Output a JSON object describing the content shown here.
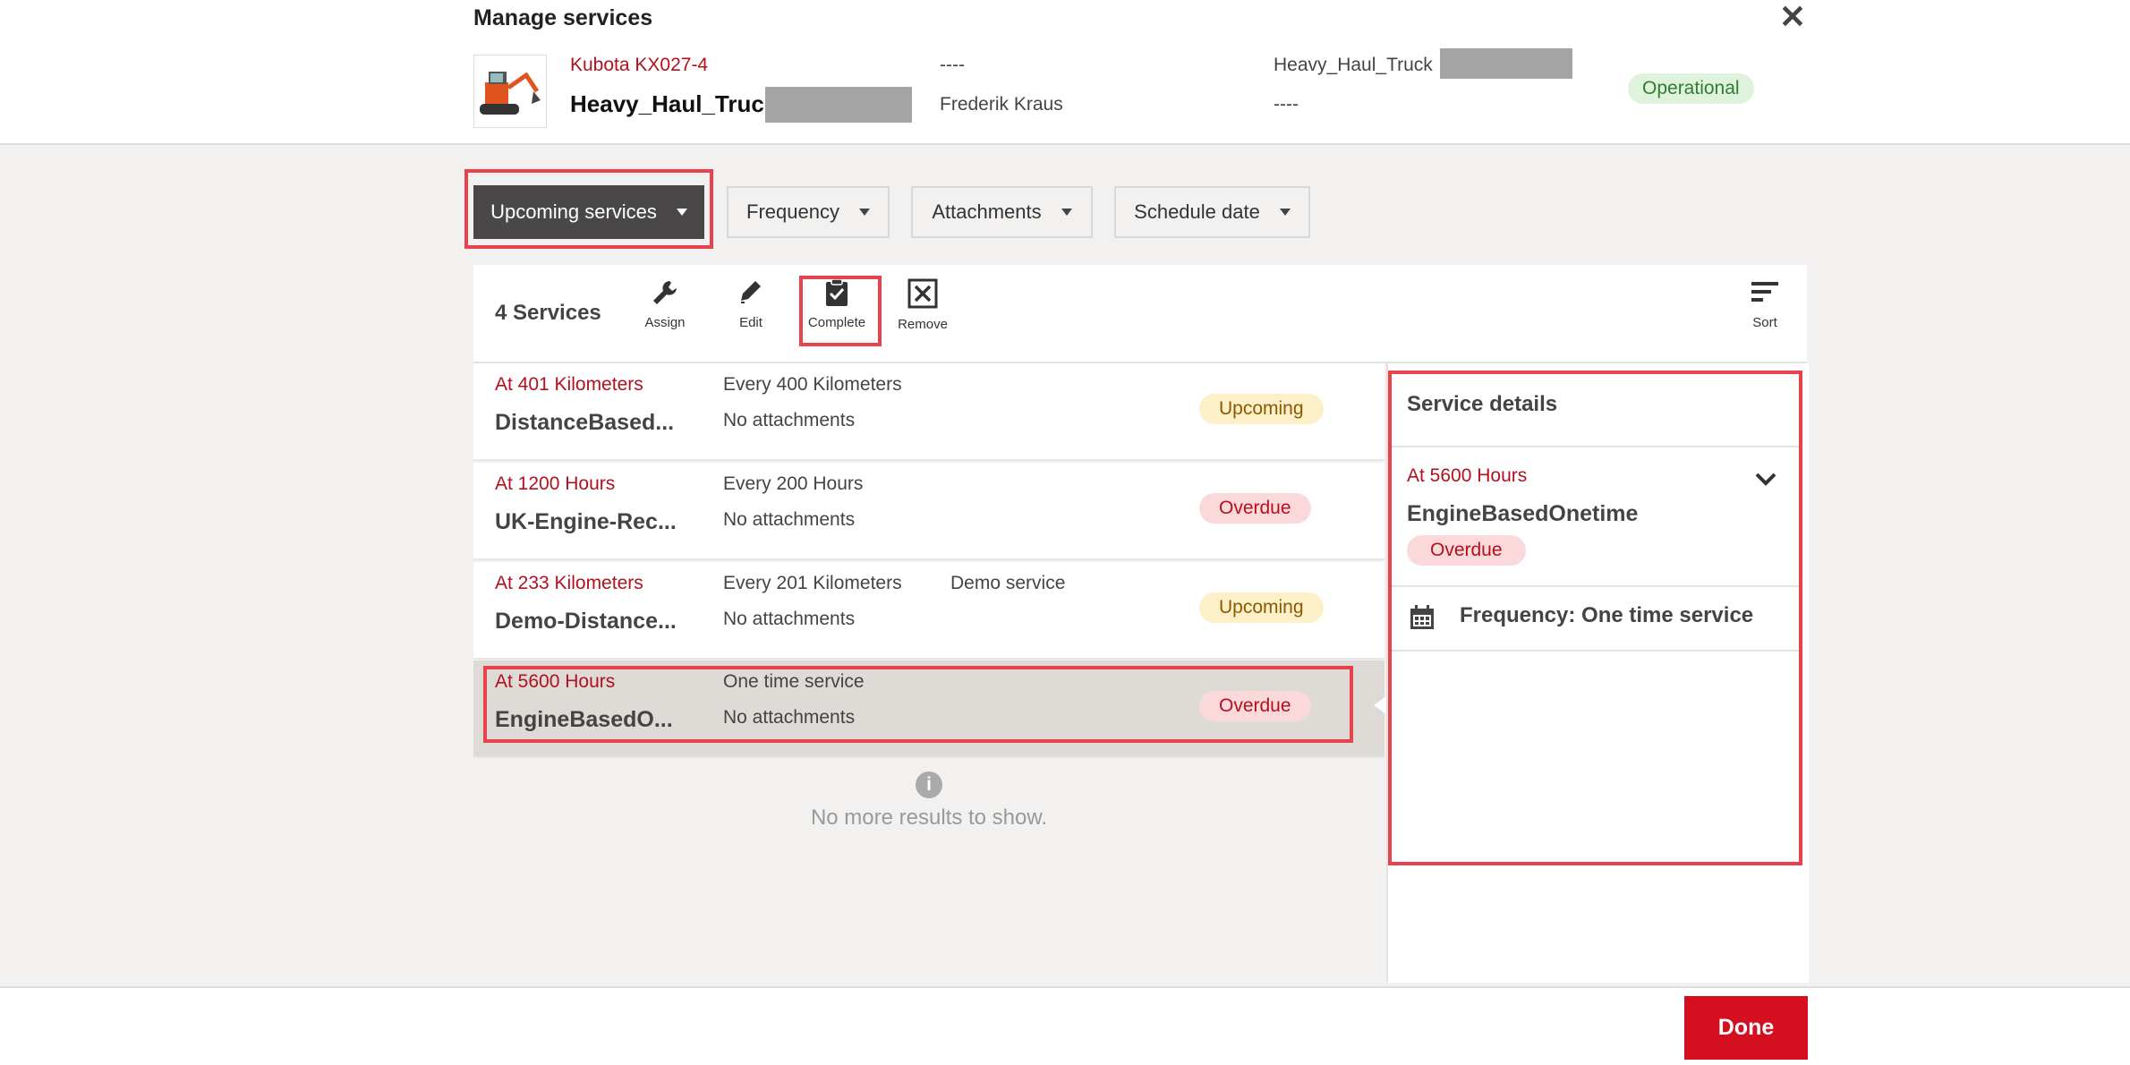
{
  "dialog": {
    "title": "Manage services",
    "close_icon": "close-icon"
  },
  "asset": {
    "model": "Kubota KX027-4",
    "name": "Heavy_Haul_Truck",
    "col2_line1": "----",
    "col2_line2": "Frederik Kraus",
    "col3_line1": "Heavy_Haul_Truck",
    "col3_line2": "----",
    "status": "Operational",
    "thumbnail_icon": "excavator-image"
  },
  "filters": [
    {
      "label": "Upcoming services"
    },
    {
      "label": "Frequency"
    },
    {
      "label": "Attachments"
    },
    {
      "label": "Schedule date"
    }
  ],
  "toolbar": {
    "count": "4 Services",
    "assign": "Assign",
    "edit": "Edit",
    "complete": "Complete",
    "remove": "Remove",
    "sort": "Sort"
  },
  "services": [
    {
      "due": "At 401 Kilometers",
      "name": "DistanceBased...",
      "frequency": "Every 400 Kilometers",
      "attachments": "No attachments",
      "extra": "",
      "status": "Upcoming"
    },
    {
      "due": "At 1200 Hours",
      "name": "UK-Engine-Rec...",
      "frequency": "Every 200 Hours",
      "attachments": "No attachments",
      "extra": "",
      "status": "Overdue"
    },
    {
      "due": "At 233 Kilometers",
      "name": "Demo-Distance...",
      "frequency": "Every 201 Kilometers",
      "attachments": "No attachments",
      "extra": "Demo service",
      "status": "Upcoming"
    },
    {
      "due": "At 5600 Hours",
      "name": "EngineBasedO...",
      "frequency": "One time service",
      "attachments": "No attachments",
      "extra": "",
      "status": "Overdue"
    }
  ],
  "no_more": "No more results to show.",
  "details": {
    "title": "Service details",
    "due": "At 5600 Hours",
    "name": "EngineBasedOnetime",
    "status": "Overdue",
    "frequency": "Frequency: One time service"
  },
  "footer": {
    "done": "Done"
  },
  "colors": {
    "accent": "#d40f1f",
    "due_text": "#b3101e",
    "highlight": "#e8434c"
  }
}
